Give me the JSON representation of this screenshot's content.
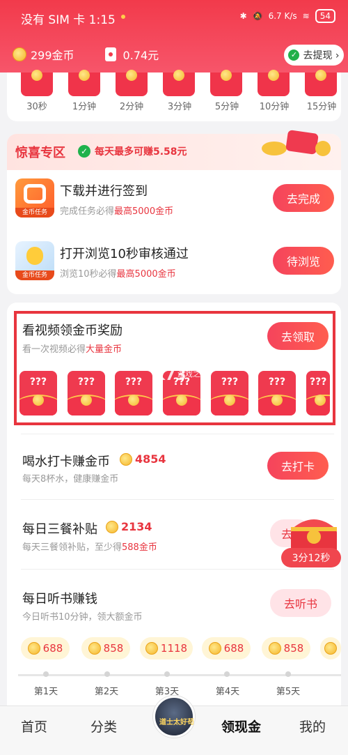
{
  "status": {
    "carrier": "没有 SIM 卡 1:15",
    "speed": "6.7 K/s",
    "battery": "54"
  },
  "header": {
    "coins": "299金币",
    "cash": "0.74元",
    "withdraw": "去提现 ›"
  },
  "timeline": {
    "labels": [
      "30秒",
      "1分钟",
      "2分钟",
      "3分钟",
      "5分钟",
      "10分钟",
      "15分钟"
    ]
  },
  "surprise": {
    "title": "惊喜专区",
    "subtitle": "每天最多可赚5.58元",
    "tasks": [
      {
        "title": "下载并进行签到",
        "sub_prefix": "完成任务必得",
        "sub_hl": "最高5000金币",
        "badge": "金币任务",
        "button": "去完成"
      },
      {
        "title": "打开浏览10秒审核通过",
        "sub_prefix": "浏览10秒必得",
        "sub_hl": "最高5000金币",
        "badge": "金币任务",
        "button": "待浏览"
      }
    ]
  },
  "video": {
    "title": "看视频领金币奖励",
    "sub_prefix": "看一次视频必得",
    "sub_hl": "大量金币",
    "button": "去领取",
    "envelope_text": "???"
  },
  "watermark": {
    "logo": "K73",
    "site": "游戏之家"
  },
  "tasks": [
    {
      "title": "喝水打卡赚金币",
      "points": "4854",
      "sub": "每天8杯水，健康赚金币",
      "button": "去打卡"
    },
    {
      "title": "每日三餐补贴",
      "points": "2134",
      "sub_prefix": "每天三餐领补贴，至少得",
      "sub_hl": "588金币",
      "button": "去"
    },
    {
      "title": "每日听书赚钱",
      "sub": "今日听书10分钟，领大额金币",
      "button": "去听书"
    }
  ],
  "chest": {
    "timer": "3分12秒"
  },
  "checkin": {
    "values": [
      "688",
      "858",
      "1118",
      "688",
      "858",
      ""
    ],
    "days": [
      "第1天",
      "第2天",
      "第3天",
      "第4天",
      "第5天"
    ]
  },
  "tabbar": {
    "home": "首页",
    "category": "分类",
    "center": "道士太好苟",
    "cash": "领现金",
    "mine": "我的"
  }
}
